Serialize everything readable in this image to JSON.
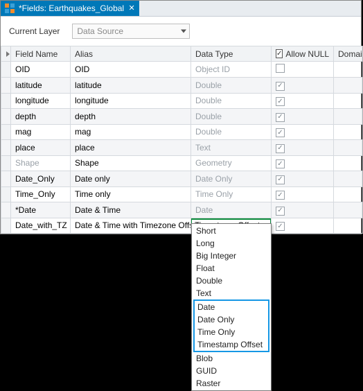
{
  "tab": {
    "title": "*Fields: Earthquakes_Global"
  },
  "toolbar": {
    "label": "Current Layer",
    "source_placeholder": "Data Source"
  },
  "columns": {
    "field": "Field Name",
    "alias": "Alias",
    "type": "Data Type",
    "allow_null": "Allow NULL",
    "domain": "Domain"
  },
  "null_header_checked": true,
  "rows": [
    {
      "field": "OID",
      "alias": "OID",
      "type": "Object ID",
      "null": false,
      "dim_field": false,
      "dim_type": true
    },
    {
      "field": "latitude",
      "alias": "latitude",
      "type": "Double",
      "null": true,
      "dim_field": false,
      "dim_type": true
    },
    {
      "field": "longitude",
      "alias": "longitude",
      "type": "Double",
      "null": true,
      "dim_field": false,
      "dim_type": true
    },
    {
      "field": "depth",
      "alias": "depth",
      "type": "Double",
      "null": true,
      "dim_field": false,
      "dim_type": true
    },
    {
      "field": "mag",
      "alias": "mag",
      "type": "Double",
      "null": true,
      "dim_field": false,
      "dim_type": true
    },
    {
      "field": "place",
      "alias": "place",
      "type": "Text",
      "null": true,
      "dim_field": false,
      "dim_type": true
    },
    {
      "field": "Shape",
      "alias": "Shape",
      "type": "Geometry",
      "null": true,
      "dim_field": true,
      "dim_type": true
    },
    {
      "field": "Date_Only",
      "alias": "Date only",
      "type": "Date Only",
      "null": true,
      "dim_field": false,
      "dim_type": true
    },
    {
      "field": "Time_Only",
      "alias": "Time only",
      "type": "Time Only",
      "null": true,
      "dim_field": false,
      "dim_type": true
    },
    {
      "field": "*Date",
      "alias": "Date & Time",
      "type": "Date",
      "null": true,
      "dim_field": false,
      "dim_type": true
    },
    {
      "field": "Date_with_TZ",
      "alias": "Date & Time with Timezone Offset",
      "type": "Timestamp Offset",
      "null": true,
      "dim_field": false,
      "dim_type": false,
      "editing": true
    }
  ],
  "dropdown": {
    "options_top": [
      "Short",
      "Long",
      "Big Integer",
      "Float",
      "Double",
      "Text"
    ],
    "options_selected": [
      "Date",
      "Date Only",
      "Time Only",
      "Timestamp Offset"
    ],
    "options_bottom": [
      "Blob",
      "GUID",
      "Raster"
    ]
  }
}
